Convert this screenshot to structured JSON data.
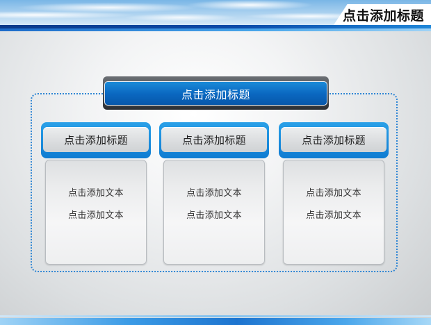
{
  "slide": {
    "title": "点击添加标题",
    "main_header": "点击添加标题",
    "columns": [
      {
        "header": "点击添加标题",
        "lines": [
          "点击添加文本",
          "点击添加文本"
        ]
      },
      {
        "header": "点击添加标题",
        "lines": [
          "点击添加文本",
          "点击添加文本"
        ]
      },
      {
        "header": "点击添加标题",
        "lines": [
          "点击添加文本",
          "点击添加文本"
        ]
      }
    ]
  },
  "colors": {
    "accent_blue": "#0a66bf",
    "header_tab_blue": "#1a8ad8",
    "frame_border": "#2f86d4",
    "stripe_dark": "#0b3a8a"
  }
}
